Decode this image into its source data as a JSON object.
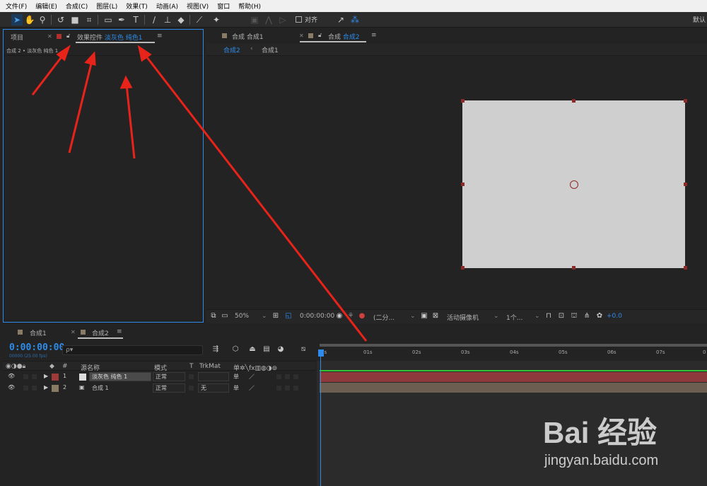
{
  "menu": [
    "文件(F)",
    "编辑(E)",
    "合成(C)",
    "图层(L)",
    "效果(T)",
    "动画(A)",
    "视图(V)",
    "窗口",
    "帮助(H)"
  ],
  "toolbar": {
    "snap_label": "对齐",
    "workspace_label": "默认"
  },
  "left_panel": {
    "tab_project": "项目",
    "tab_effects_prefix": "效果控件",
    "tab_effects_layer": "淡灰色 纯色1",
    "breadcrumb": "合成 2 • 淡灰色 纯色 1"
  },
  "viewer": {
    "tab1": "合成 合成1",
    "tab2_prefix": "合成",
    "tab2_name": "合成2",
    "crumb_active": "合成2",
    "crumb_other": "合成1",
    "zoom": "50%",
    "timecode": "0:00:00:00",
    "resolution": "(二分...",
    "camera": "活动摄像机",
    "views": "1个...",
    "exposure": "+0.0"
  },
  "timeline": {
    "tab1": "合成1",
    "tab2": "合成2",
    "timecode": "0:00:00:00",
    "frames": "00000 (25.00 fps)",
    "search_placeholder": "ρ▾",
    "columns": {
      "num": "#",
      "source": "源名称",
      "mode": "模式",
      "t": "T",
      "trkmat": "TrkMat"
    },
    "layers": [
      {
        "num": "1",
        "name": "淡灰色 纯色 1",
        "mode": "正常",
        "trkmat": "",
        "color": "#a03a3a"
      },
      {
        "num": "2",
        "name": "合成 1",
        "mode": "正常",
        "trkmat": "无",
        "color": "#8a7b66"
      }
    ],
    "ruler_ticks": [
      "0s",
      "01s",
      "02s",
      "03s",
      "04s",
      "05s",
      "06s",
      "07s",
      "0"
    ]
  },
  "watermark": {
    "logo": "Bai 经验",
    "url": "jingyan.baidu.com"
  },
  "colors": {
    "accent": "#2d8ceb",
    "solid_layer": "#cfcfcf",
    "annotation_arrow": "#e8231a"
  }
}
